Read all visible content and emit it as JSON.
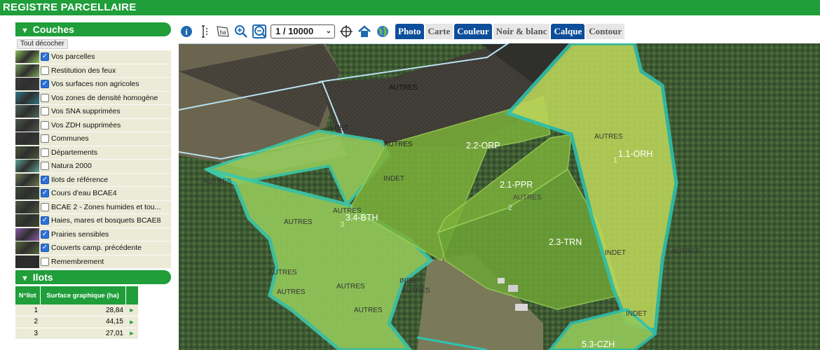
{
  "app": {
    "title": "REGISTRE PARCELLAIRE"
  },
  "couches": {
    "header": "Couches",
    "tout_decocher": "Tout décocher",
    "layers": [
      {
        "label": "Vos parcelles",
        "checked": true,
        "thumb": "#8fc45a"
      },
      {
        "label": "Restitution des feux",
        "checked": false,
        "thumb": "#7aa35c"
      },
      {
        "label": "Vos surfaces non agricoles",
        "checked": true,
        "thumb": "#3b3b3b"
      },
      {
        "label": "Vos zones de densité homogène",
        "checked": false,
        "thumb": "#2c7a8a"
      },
      {
        "label": "Vos SNA supprimées",
        "checked": false,
        "thumb": "#4c6a5a"
      },
      {
        "label": "Vos ZDH supprimées",
        "checked": false,
        "thumb": "#505a50"
      },
      {
        "label": "Communes",
        "checked": false,
        "thumb": "#3a3a3a"
      },
      {
        "label": "Départements",
        "checked": false,
        "thumb": "#4d5a3a"
      },
      {
        "label": "Natura 2000",
        "checked": false,
        "thumb": "#5fa59a"
      },
      {
        "label": "Ilots de référence",
        "checked": true,
        "thumb": "#6d7a52"
      },
      {
        "label": "Cours d'eau BCAE4",
        "checked": true,
        "thumb": "#3a4a3a"
      },
      {
        "label": "BCAE 2 - Zones humides et tou...",
        "checked": false,
        "thumb": "#4e5a40"
      },
      {
        "label": "Haies, mares et bosquets BCAE8",
        "checked": true,
        "thumb": "#3e4a30"
      },
      {
        "label": "Prairies sensibles",
        "checked": true,
        "thumb": "#8a5aa6"
      },
      {
        "label": "Couverts camp. précédente",
        "checked": true,
        "thumb": "#5a6a3a"
      },
      {
        "label": "Remembrement",
        "checked": false,
        "thumb": "#2a2a2a"
      }
    ]
  },
  "ilots": {
    "header": "Ilots",
    "col_num": "N°Ilot",
    "col_surface": "Surface graphique (ha)",
    "rows": [
      {
        "num": "1",
        "surface": "28,84"
      },
      {
        "num": "2",
        "surface": "44,15"
      },
      {
        "num": "3",
        "surface": "27,01"
      }
    ]
  },
  "toolbar": {
    "scale": "1 / 10000",
    "buttons": [
      {
        "label": "Photo",
        "active": true
      },
      {
        "label": "Carte",
        "active": false
      },
      {
        "label": "Couleur",
        "active": true
      },
      {
        "label": "Noir & blanc",
        "active": false
      },
      {
        "label": "Calque",
        "active": true
      },
      {
        "label": "Contour",
        "active": false
      }
    ]
  },
  "map": {
    "parcel_labels": [
      "2.2-ORP",
      "1.1-ORH",
      "2.1-PPR",
      "3.4-BTH",
      "2.3-TRN",
      "5.3-CZH"
    ],
    "ilot_numbers": [
      "1",
      "2",
      "3"
    ],
    "autres_label": "AUTRES",
    "indet_label": "INDET"
  },
  "colors": {
    "brand_green": "#1f9e3a",
    "active_blue": "#0d4e9b",
    "parcel_green": "#7fc23a",
    "parcel_yellow": "#bcd65a",
    "border_teal": "#2fc3b0"
  }
}
